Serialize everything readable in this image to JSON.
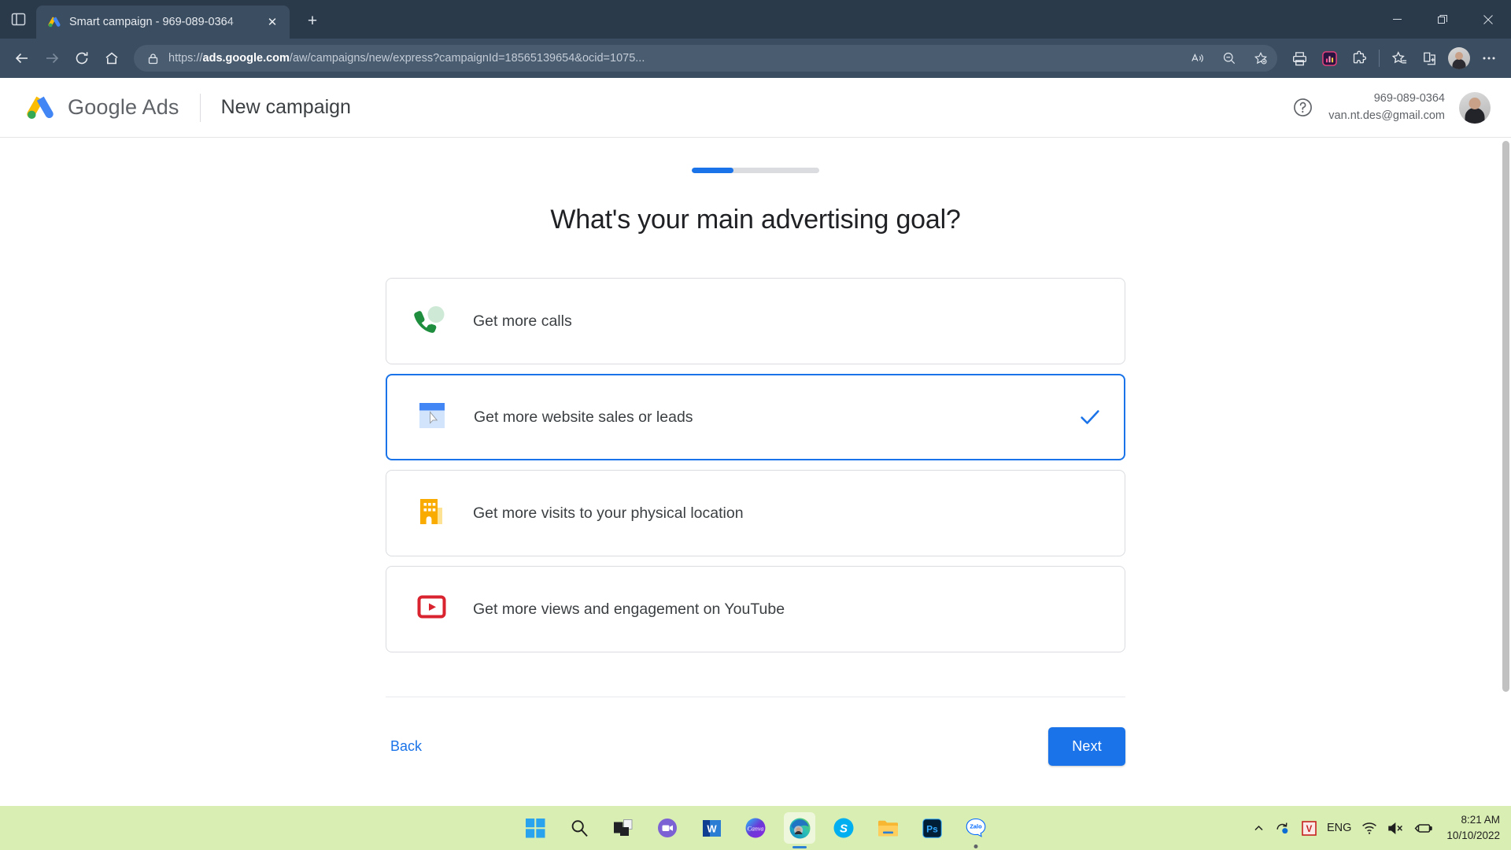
{
  "browser": {
    "tab": {
      "title": "Smart campaign - 969-089-0364",
      "favicon_name": "google-ads-favicon",
      "close_label": "✕"
    },
    "new_tab_label": "+",
    "window_controls": {
      "minimize": "—",
      "maximize": "❐",
      "close": "✕"
    },
    "nav": {
      "back_label": "←",
      "forward_label": "→",
      "refresh_label": "↻",
      "home_label": "⌂"
    },
    "omnibox": {
      "url_scheme": "https://",
      "url_domain": "ads.google.com",
      "url_path": "/aw/campaigns/new/express?campaignId=18565139654&ocid=1075...",
      "full_url": "https://ads.google.com/aw/campaigns/new/express?campaignId=18565139654&ocid=1075...",
      "lock_icon": "lock-icon"
    },
    "toolbar_icons": [
      "read-aloud-icon",
      "zoom-out-icon",
      "add-favorite-icon",
      "printer-icon",
      "extension-pink-icon",
      "puzzle-extensions-icon",
      "favorites-icon",
      "collections-icon",
      "profile-avatar",
      "settings-more-icon"
    ]
  },
  "app": {
    "brand_google": "Google",
    "brand_ads": "Ads",
    "page_title": "New campaign",
    "help_icon": "help-circle-icon",
    "account": {
      "id": "969-089-0364",
      "email": "van.nt.des@gmail.com"
    }
  },
  "wizard": {
    "progress_percent": 33,
    "heading": "What's your main advertising goal?",
    "goals": [
      {
        "label": "Get more calls",
        "icon": "phone-call-icon",
        "selected": false
      },
      {
        "label": "Get more website sales or leads",
        "icon": "website-cursor-icon",
        "selected": true
      },
      {
        "label": "Get more visits to your physical location",
        "icon": "storefront-building-icon",
        "selected": false
      },
      {
        "label": "Get more views and engagement on YouTube",
        "icon": "youtube-play-icon",
        "selected": false
      }
    ],
    "selected_check": "check-icon",
    "back_label": "Back",
    "next_label": "Next"
  },
  "colors": {
    "accent_blue": "#1a73e8",
    "call_green": "#1e8e3e",
    "location_yellow": "#f9ab00",
    "youtube_red": "#d9232e",
    "taskbar_green": "#d9eeb2",
    "chrome_dark": "#2b3a4b"
  },
  "taskbar": {
    "items": [
      {
        "name": "start-button",
        "label": "Start"
      },
      {
        "name": "search-icon",
        "label": "Search"
      },
      {
        "name": "task-view-icon",
        "label": "Task View"
      },
      {
        "name": "microsoft-teams-icon",
        "label": "Microsoft Teams"
      },
      {
        "name": "microsoft-word-icon",
        "label": "Word"
      },
      {
        "name": "canva-icon",
        "label": "Canva"
      },
      {
        "name": "microsoft-edge-icon",
        "label": "Microsoft Edge"
      },
      {
        "name": "skype-icon",
        "label": "Skype"
      },
      {
        "name": "file-explorer-icon",
        "label": "File Explorer"
      },
      {
        "name": "photoshop-icon",
        "label": "Adobe Photoshop"
      },
      {
        "name": "zalo-icon",
        "label": "Zalo"
      }
    ],
    "word_glyph": "W",
    "canva_glyph": "Canva",
    "skype_glyph": "S",
    "photoshop_glyph": "Ps",
    "zalo_glyph": "Zalo",
    "tray": {
      "chevron": "show-hidden-icons",
      "sync_icon": "onedrive-sync-icon",
      "v_icon": "unikey-v-icon",
      "language": "ENG",
      "wifi_icon": "wifi-icon",
      "volume_icon": "volume-muted-icon",
      "battery_icon": "battery-charging-icon",
      "time": "8:21 AM",
      "date": "10/10/2022"
    }
  }
}
